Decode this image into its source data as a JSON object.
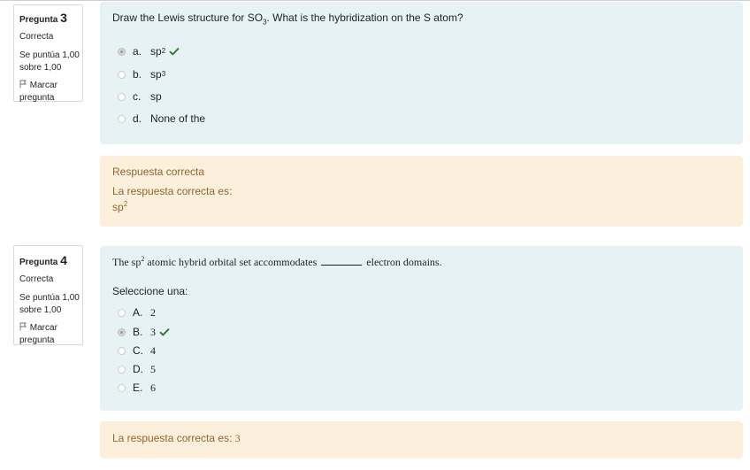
{
  "q3": {
    "label": "Pregunta",
    "number": "3",
    "state": "Correcta",
    "grade": "Se puntúa 1,00 sobre 1,00",
    "flag": "Marcar pregunta",
    "question_pre": "Draw the Lewis structure for SO",
    "question_sub": "3",
    "question_post": ". What is the hybridization on the S atom?",
    "options": [
      {
        "letter": "a.",
        "text": "sp",
        "sup": "2",
        "checked": true,
        "correct_mark": true
      },
      {
        "letter": "b.",
        "text": "sp",
        "sup": "3",
        "checked": false,
        "correct_mark": false
      },
      {
        "letter": "c.",
        "text": "sp",
        "sup": "",
        "checked": false,
        "correct_mark": false
      },
      {
        "letter": "d.",
        "text": "None of the",
        "sup": "",
        "checked": false,
        "correct_mark": false
      }
    ],
    "feedback_title": "Respuesta correcta",
    "feedback_line": "La respuesta correcta es:",
    "feedback_answer": "sp",
    "feedback_answer_sup": "2"
  },
  "q4": {
    "label": "Pregunta",
    "number": "4",
    "state": "Correcta",
    "grade": "Se puntúa 1,00 sobre 1,00",
    "flag": "Marcar pregunta",
    "question_pre": "The sp",
    "question_sup": "2",
    "question_mid": " atomic hybrid orbital set accommodates ",
    "question_post": " electron domains.",
    "select_prompt": "Seleccione una:",
    "options": [
      {
        "letter": "A.",
        "text": "2",
        "checked": false,
        "correct_mark": false
      },
      {
        "letter": "B.",
        "text": "3",
        "checked": true,
        "correct_mark": true
      },
      {
        "letter": "C.",
        "text": "4",
        "checked": false,
        "correct_mark": false
      },
      {
        "letter": "D.",
        "text": "5",
        "checked": false,
        "correct_mark": false
      },
      {
        "letter": "E.",
        "text": "6",
        "checked": false,
        "correct_mark": false
      }
    ],
    "feedback_label": "La respuesta correcta es: ",
    "feedback_value": "3"
  },
  "colors": {
    "check": "#357a32",
    "info_bg": "#e7f2f5",
    "feedback_bg": "#fcefdc",
    "feedback_text": "#8e662e"
  }
}
